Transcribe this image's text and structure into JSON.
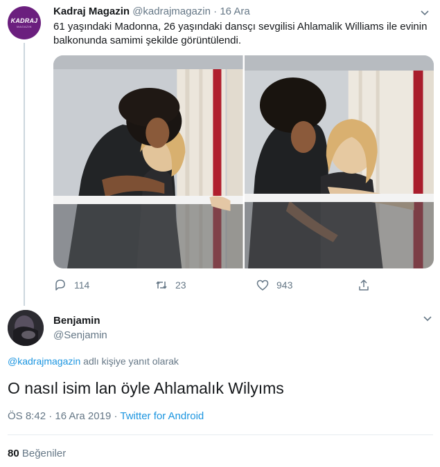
{
  "tweet": {
    "author_name": "Kadraj Magazin",
    "author_handle": "@kadrajmagazin",
    "separator": "·",
    "date": "16 Ara",
    "avatar_text": "KADRAJ",
    "avatar_subtext": "MAGAZIN",
    "text": "61 yaşındaki Madonna, 26 yaşındaki dansçı sevgilisi Ahlamalik Williams ile evinin balkonunda samimi şekilde görüntülendi.",
    "actions": {
      "reply_count": "114",
      "retweet_count": "23",
      "like_count": "943"
    }
  },
  "reply": {
    "author_name": "Benjamin",
    "author_handle": "@Senjamin",
    "reply_to_handle": "@kadrajmagazin",
    "reply_to_suffix": " adlı kişiye yanıt olarak",
    "text": "O nasıl isim lan öyle Ahlamalık Wilyıms",
    "time": "ÖS 8:42",
    "separator1": " · ",
    "date": "16 Ara 2019",
    "separator2": " · ",
    "source": "Twitter for Android",
    "likes_count": "80",
    "likes_label": " Beğeniler"
  },
  "colors": {
    "accent": "#1b95e0",
    "secondary_text": "#657786",
    "avatar_brand": "#6b1f7e"
  },
  "icons": [
    "chevron-down-icon",
    "reply-icon",
    "retweet-icon",
    "like-icon",
    "share-icon"
  ]
}
